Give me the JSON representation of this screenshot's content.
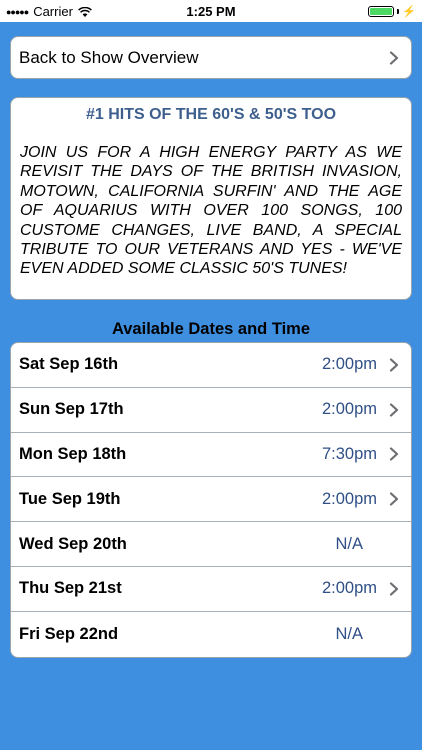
{
  "status_bar": {
    "carrier": "Carrier",
    "time": "1:25 PM"
  },
  "back_button": {
    "label": "Back to Show Overview"
  },
  "show": {
    "title": "#1 HITS OF THE 60'S & 50'S TOO",
    "description": "JOIN US FOR A HIGH ENERGY PARTY AS WE REVISIT THE DAYS OF THE BRITISH INVASION, MOTOWN, CALIFORNIA SURFIN' AND THE AGE OF AQUARIUS WITH OVER 100 SONGS, 100 CUSTOME CHANGES, LIVE BAND, A SPECIAL TRIBUTE TO OUR VETERANS AND YES - WE'VE EVEN ADDED SOME CLASSIC 50'S TUNES!"
  },
  "dates_section": {
    "heading": "Available Dates and Time",
    "rows": [
      {
        "date": "Sat Sep 16th",
        "time": "2:00pm",
        "available": true
      },
      {
        "date": "Sun Sep 17th",
        "time": "2:00pm",
        "available": true
      },
      {
        "date": "Mon Sep 18th",
        "time": "7:30pm",
        "available": true
      },
      {
        "date": "Tue Sep 19th",
        "time": "2:00pm",
        "available": true
      },
      {
        "date": "Wed Sep 20th",
        "time": "N/A",
        "available": false
      },
      {
        "date": "Thu Sep 21st",
        "time": "2:00pm",
        "available": true
      },
      {
        "date": "Fri Sep 22nd",
        "time": "N/A",
        "available": false
      }
    ]
  },
  "icons": {
    "signal": "signal-dots-icon",
    "wifi": "wifi-icon",
    "battery": "battery-icon",
    "charging": "bolt-icon",
    "disclosure": "chevron-right-icon"
  },
  "colors": {
    "background": "#3f8fe0",
    "title_text": "#3e5f8e",
    "time_text": "#2f4f86",
    "battery_fill": "#4cd964"
  }
}
